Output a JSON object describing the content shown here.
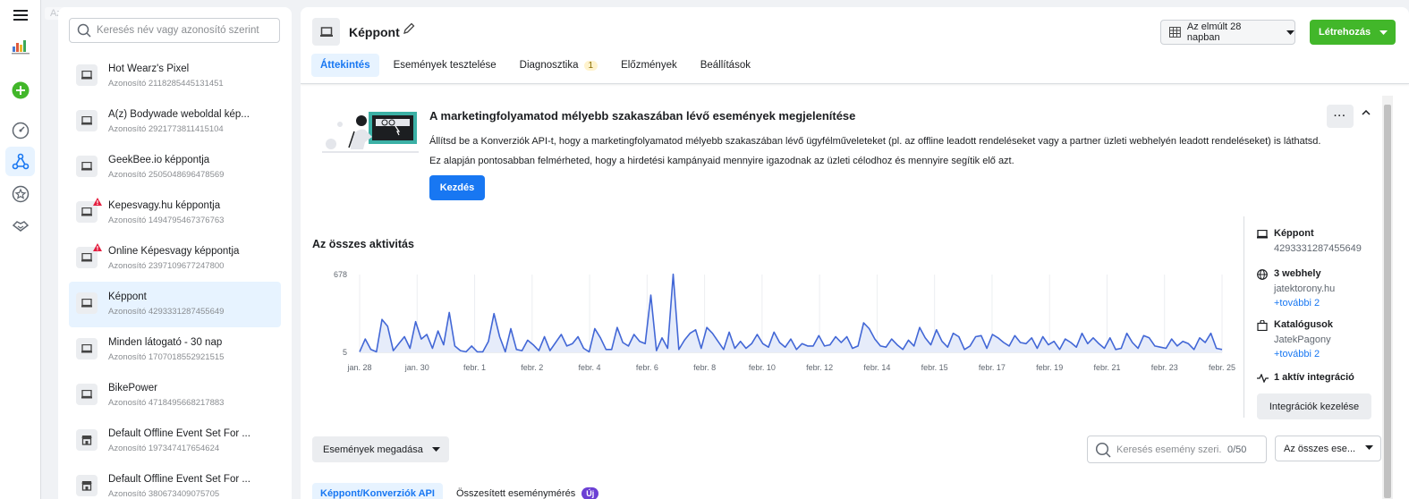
{
  "rail": {
    "tooltip": "Az összes eszköz"
  },
  "sidebar": {
    "search_placeholder": "Keresés név vagy azonosító szerint",
    "items": [
      {
        "name": "Hot Wearz's Pixel",
        "id": "Azonosító 2118285445131451",
        "warning": false,
        "icon": "monitor-icon"
      },
      {
        "name": "A(z) Bodywade weboldal kép...",
        "id": "Azonosító 2921773811415104",
        "warning": false,
        "icon": "monitor-icon"
      },
      {
        "name": "GeekBee.io képpontja",
        "id": "Azonosító 2505048696478569",
        "warning": false,
        "icon": "monitor-icon"
      },
      {
        "name": "Kepesvagy.hu képpontja",
        "id": "Azonosító 1494795467376763",
        "warning": true,
        "icon": "monitor-icon"
      },
      {
        "name": "Online Képesvagy képpontja",
        "id": "Azonosító 2397109677247800",
        "warning": true,
        "icon": "monitor-icon"
      },
      {
        "name": "Képpont",
        "id": "Azonosító 4293331287455649",
        "warning": false,
        "icon": "monitor-icon",
        "selected": true
      },
      {
        "name": "Minden látogató - 30 nap",
        "id": "Azonosító 1707018552921515",
        "warning": false,
        "icon": "monitor-icon"
      },
      {
        "name": "BikePower",
        "id": "Azonosító 4718495668217883",
        "warning": false,
        "icon": "monitor-icon"
      },
      {
        "name": "Default Offline Event Set For ...",
        "id": "Azonosító 197347417654624",
        "warning": false,
        "icon": "store-icon"
      },
      {
        "name": "Default Offline Event Set For ...",
        "id": "Azonosító 380673409075705",
        "warning": false,
        "icon": "store-icon"
      }
    ]
  },
  "header": {
    "title": "Képpont",
    "date_range": "Az elmúlt 28 napban",
    "create_label": "Létrehozás",
    "tabs": [
      {
        "label": "Áttekintés",
        "active": true
      },
      {
        "label": "Események tesztelése"
      },
      {
        "label": "Diagnosztika",
        "badge": "1"
      },
      {
        "label": "Előzmények"
      },
      {
        "label": "Beállítások"
      }
    ]
  },
  "promo": {
    "title": "A marketingfolyamatod mélyebb szakaszában lévő események megjelenítése",
    "text1": "Állítsd be a Konverziók API-t, hogy a marketingfolyamatod mélyebb szakaszában lévő ügyfélműveleteket (pl. az offline leadott rendeléseket vagy a partner üzleti webhelyén leadott rendeléseket) is láthatsd.",
    "text2": "Ez alapján pontosabban felmérheted, hogy a hirdetési kampányaid mennyire igazodnak az üzleti célodhoz és mennyire segítik elő azt.",
    "button": "Kezdés",
    "more": "···"
  },
  "activity": {
    "title": "Az összes aktivitás"
  },
  "chart_data": {
    "type": "area",
    "ylim": [
      5,
      678
    ],
    "y_ticks": [
      "678",
      "5"
    ],
    "x_tick_labels": [
      "jan. 28",
      "jan. 30",
      "febr. 1",
      "febr. 2",
      "febr. 4",
      "febr. 6",
      "febr. 8",
      "febr. 10",
      "febr. 12",
      "febr. 14",
      "febr. 15",
      "febr. 17",
      "febr. 19",
      "febr. 21",
      "febr. 23",
      "febr. 25"
    ],
    "values": [
      10,
      120,
      30,
      10,
      290,
      230,
      20,
      80,
      140,
      40,
      270,
      120,
      160,
      40,
      190,
      70,
      350,
      60,
      20,
      10,
      60,
      10,
      10,
      100,
      340,
      140,
      10,
      210,
      30,
      20,
      110,
      70,
      20,
      140,
      20,
      90,
      160,
      60,
      80,
      140,
      40,
      10,
      210,
      130,
      30,
      30,
      220,
      90,
      60,
      160,
      100,
      80,
      500,
      20,
      130,
      40,
      680,
      30,
      110,
      170,
      200,
      40,
      220,
      170,
      100,
      30,
      180,
      40,
      100,
      40,
      80,
      160,
      80,
      50,
      180,
      90,
      50,
      120,
      30,
      80,
      60,
      60,
      150,
      60,
      70,
      140,
      90,
      140,
      40,
      60,
      260,
      210,
      120,
      60,
      50,
      120,
      70,
      30,
      110,
      60,
      220,
      130,
      70,
      200,
      100,
      50,
      170,
      140,
      30,
      60,
      140,
      150,
      40,
      160,
      130,
      90,
      60,
      150,
      90,
      80,
      130,
      40,
      140,
      70,
      100,
      30,
      120,
      90,
      50,
      170,
      80,
      130,
      80,
      40,
      130,
      30,
      40,
      170,
      90,
      40,
      150,
      130,
      60,
      50,
      40,
      120,
      60,
      100,
      80,
      30,
      130,
      90,
      170,
      40,
      30
    ],
    "line_color": "#4267d6",
    "fill_color": "#e6ecfa"
  },
  "info": {
    "pixel_label": "Képpont",
    "pixel_id": "4293331287455649",
    "websites_label": "3 webhely",
    "website": "jatektorony.hu",
    "websites_more": "+további 2",
    "catalogs_label": "Katalógusok",
    "catalog": "JatekPagony",
    "catalogs_more": "+további 2",
    "integration": "1 aktív integráció",
    "manage_button": "Integrációk kezelése"
  },
  "events": {
    "add_label": "Események megadása",
    "search_placeholder": "Keresés esemény szeri...",
    "count": "0/50",
    "filter_label": "Az összes ese...",
    "subtabs": [
      {
        "label": "Képpont/Konverziók API",
        "active": true
      },
      {
        "label": "Összesített eseménymérés",
        "badge": "Új"
      }
    ]
  },
  "colors": {
    "accent": "#1877f2",
    "create": "#42b72a",
    "warning": "#e41e3f"
  }
}
